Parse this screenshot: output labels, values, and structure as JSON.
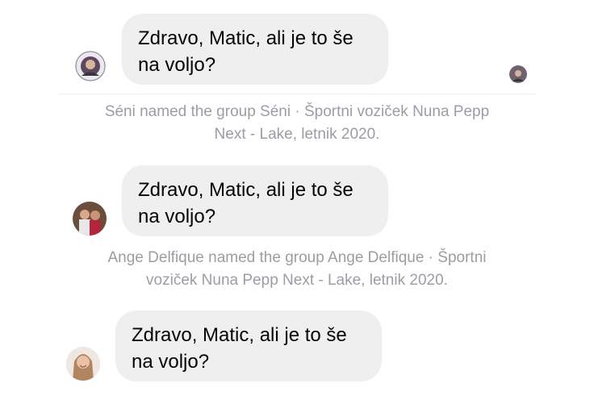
{
  "messages": [
    {
      "text": "Zdravo, Matic, ali je to še\nna voljo?"
    },
    {
      "text": "Zdravo, Matic, ali je to še\nna voljo?"
    },
    {
      "text": "Zdravo, Matic, ali je to še\nna voljo?"
    }
  ],
  "system_notices": [
    {
      "text": "Séni named the group Séni · Športni voziček Nuna Pepp\nNext - Lake, letnik 2020."
    },
    {
      "text": "Ange Delfique named the group Ange Delfique · Športni\nvoziček Nuna Pepp Next - Lake, letnik 2020."
    }
  ],
  "colors": {
    "bubble_bg": "#efefef",
    "system_text": "#9a9ea4",
    "message_text": "#050505"
  }
}
